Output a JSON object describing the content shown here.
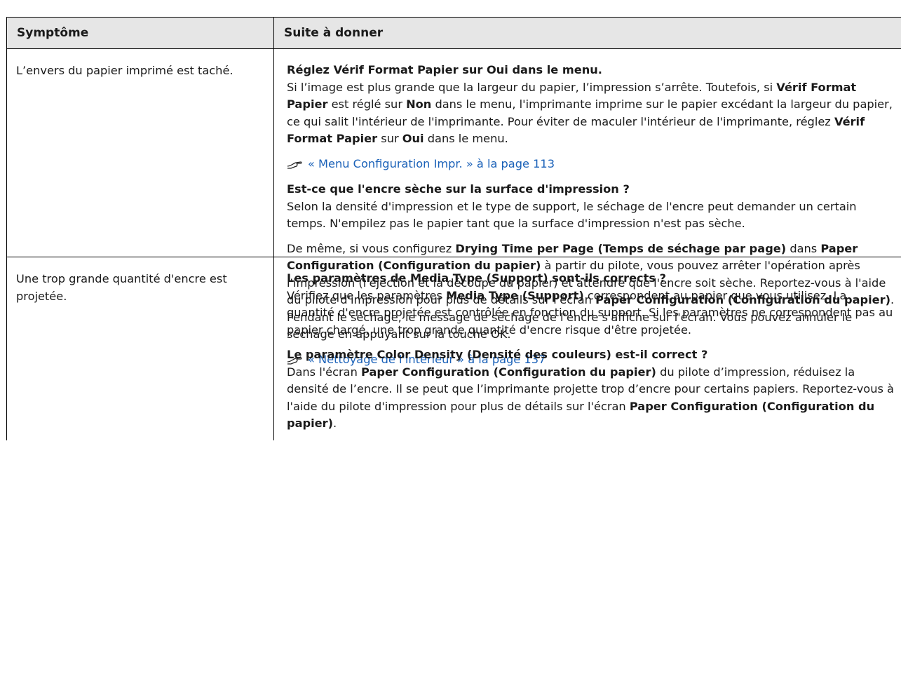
{
  "header": {
    "col1": "Symptôme",
    "col2": "Suite à donner"
  },
  "row1": {
    "symptom": "L’envers du papier imprimé est taché.",
    "b1": {
      "lead": "Réglez Vérif Format Papier sur Oui dans le menu.",
      "t1": "Si l’image est plus grande que la largeur du papier, l’impression s’arrête. Toutefois, si ",
      "k1": "Vérif Format Papier",
      "t2": " est réglé sur ",
      "k2": "Non",
      "t3": " dans le menu, l'imprimante imprime sur le papier excédant la largeur du papier, ce qui salit l'intérieur de l'imprimante. Pour éviter de maculer l'intérieur de l'imprimante, réglez ",
      "k3": "Vérif Format Papier",
      "t4": " sur ",
      "k4": "Oui",
      "t5": " dans le menu."
    },
    "link1": "« Menu Configuration Impr. » à la page 113",
    "b2": {
      "lead": "Est-ce que l'encre sèche sur la surface d'impression ?",
      "text": "Selon la densité d'impression et le type de support, le séchage de l'encre peut demander un certain temps. N'empilez pas le papier tant que la surface d'impression n'est pas sèche."
    },
    "b3": {
      "t1": "De même, si vous configurez ",
      "k1": "Drying Time per Page (Temps de séchage par page)",
      "t2": " dans ",
      "k2": "Paper Configuration (Configuration du papier)",
      "t3": " à partir du pilote, vous pouvez arrêter l'opération après l'impression (l'éjection et la découpe du papier) et attendre que l'encre soit sèche. Reportez-vous à l'aide du pilote d'impression pour plus de détails sur l'écran ",
      "k3": "Paper Configuration (Configuration du papier)",
      "t4": ". Pendant le séchage, le message de séchage de l'encre s'affiche sur l'écran. Vous pouvez annuler le séchage en appuyant sur la touche OK."
    },
    "link2": "« Nettoyage de l'intérieur » à la page 137"
  },
  "row2": {
    "symptom": "Une trop grande quantité d'encre est projetée.",
    "b1": {
      "lead": "Les paramètres de Media Type (Support) sont-ils corrects ?",
      "t1": "Vérifiez que les paramètres ",
      "k1": "Media Type (Support)",
      "t2": " correspondent au papier que vous utilisez. La quantité d'encre projetée est contrôlée en fonction du support. Si les paramètres ne correspondent pas au papier chargé, une trop grande quantité d'encre risque d'être projetée."
    },
    "b2": {
      "lead": "Le paramètre Color Density (Densité des couleurs) est-il correct ?",
      "t1": "Dans l'écran ",
      "k1": "Paper Configuration (Configuration du papier)",
      "t2": " du pilote d’impression, réduisez la densité de l’encre. Il se peut que l’imprimante projette trop d’encre pour certains papiers. Reportez-vous à l'aide du pilote d'impression pour plus de détails sur l'écran ",
      "k2": "Paper Configuration (Configuration du papier)",
      "t3": "."
    }
  },
  "colors": {
    "header_bg": "#e6e6e6",
    "link": "#1a61b8"
  },
  "icons": {
    "xref": "pointing-hand-icon"
  }
}
